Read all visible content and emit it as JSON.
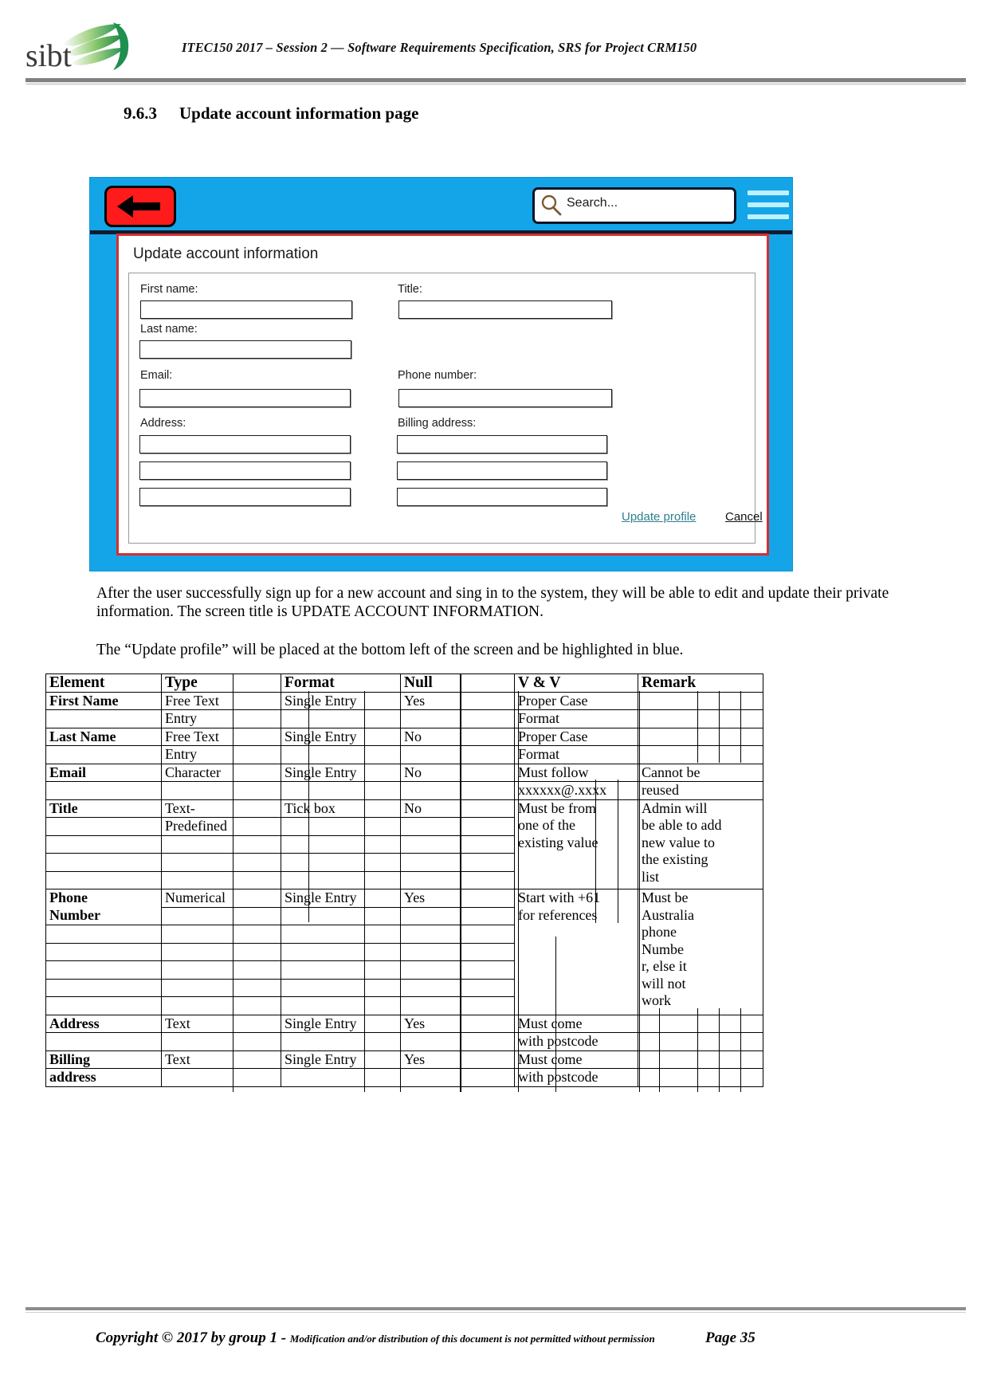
{
  "header": {
    "logo_text": "sibt",
    "title": "ITEC150 2017 – Session 2 — Software Requirements Specification, SRS for Project CRM150"
  },
  "section": {
    "number": "9.6.3",
    "title": "Update account information page"
  },
  "mockup": {
    "back_button": "back-arrow",
    "search_placeholder": "Search...",
    "menu": "hamburger",
    "card_title": "Update account information",
    "fields": {
      "first_name_label": "First name:",
      "first_name_value": "",
      "last_name_label": "Last name:",
      "last_name_value": "",
      "email_label": "Email:",
      "email_value": "",
      "address_label": "Address:",
      "address_line1": "",
      "address_line2": "",
      "address_line3": "",
      "title_label": "Title:",
      "title_value": "",
      "phone_label": "Phone number:",
      "phone_value": "",
      "billing_label": "Billing address:",
      "billing_line1": "",
      "billing_line2": "",
      "billing_line3": ""
    },
    "update_link": "Update profile",
    "cancel_link": "Cancel",
    "colors": {
      "panel": "#14A5E8",
      "back_button": "#FF1B1B",
      "card_border": "#D43030",
      "link": "#2F7F8F",
      "menu_bars": "#BDF1FF"
    }
  },
  "body": {
    "p1": "After the user successfully sign up for a new account and sing in to the system, they will be able to edit and update their private information. The screen title is UPDATE ACCOUNT INFORMATION.",
    "p2": "The “Update profile” will be placed at the bottom left of the screen and be highlighted in blue."
  },
  "table": {
    "headers": [
      "Element",
      "Type",
      "Format",
      "Null",
      "V & V",
      "Remark"
    ],
    "rows": [
      {
        "element": "First Name",
        "element2": "",
        "type": "Free Text",
        "type2": "Entry",
        "format": "Single Entry",
        "format2": "",
        "null": "Yes",
        "null2": "",
        "vv": "Proper Case",
        "vv2": "Format",
        "remark": "",
        "remark2": ""
      },
      {
        "element": "Last Name",
        "element2": "",
        "type": "Free Text",
        "type2": "Entry",
        "format": "Single Entry",
        "format2": "",
        "null": "No",
        "null2": "",
        "vv": "Proper Case",
        "vv2": "Format",
        "remark": "",
        "remark2": ""
      },
      {
        "element": "Email",
        "element2": "",
        "type": "Character",
        "type2": "",
        "format": "Single Entry",
        "format2": "",
        "null": "No",
        "null2": "",
        "vv": "Must follow",
        "vv2": "xxxxxx@.xxxx",
        "remark": "Cannot be",
        "remark2": "reused"
      },
      {
        "element": "Title",
        "element2": "",
        "type": "Text-",
        "type2": "Predefined",
        "format": "Tick box",
        "format2": "",
        "null": "No",
        "null2": "",
        "vv": "Must be from\none of the\nexisting value",
        "vv2": "",
        "remark": "Admin  will\nbe able to add\nnew value to\nthe existing\nlist",
        "remark2": ""
      },
      {
        "element": "Phone\nNumber",
        "element2": "",
        "type": "Numerical",
        "type2": "",
        "format": "Single Entry",
        "format2": "",
        "null": "Yes",
        "null2": "",
        "vv": "Start with +61\nfor references",
        "vv2": "",
        "remark": "Must be\nAustralia\nphone\nNumbe\nr, else it\nwill not\nwork",
        "remark2": ""
      },
      {
        "element": "Address",
        "element2": "",
        "type": "Text",
        "type2": "",
        "format": "Single Entry",
        "format2": "",
        "null": "Yes",
        "null2": "",
        "vv": "Must come",
        "vv2": "with postcode",
        "remark": "",
        "remark2": ""
      },
      {
        "element": "Billing",
        "element2": "address",
        "type": "Text",
        "type2": "",
        "format": "Single Entry",
        "format2": "",
        "null": "Yes",
        "null2": "",
        "vv": "Must come",
        "vv2": "with postcode",
        "remark": "",
        "remark2": ""
      }
    ]
  },
  "footer": {
    "copyright": "Copyright © 2017 by group 1 - ",
    "note": "Modification and/or distribution of this document is not permitted without permission",
    "page": "Page 35"
  }
}
